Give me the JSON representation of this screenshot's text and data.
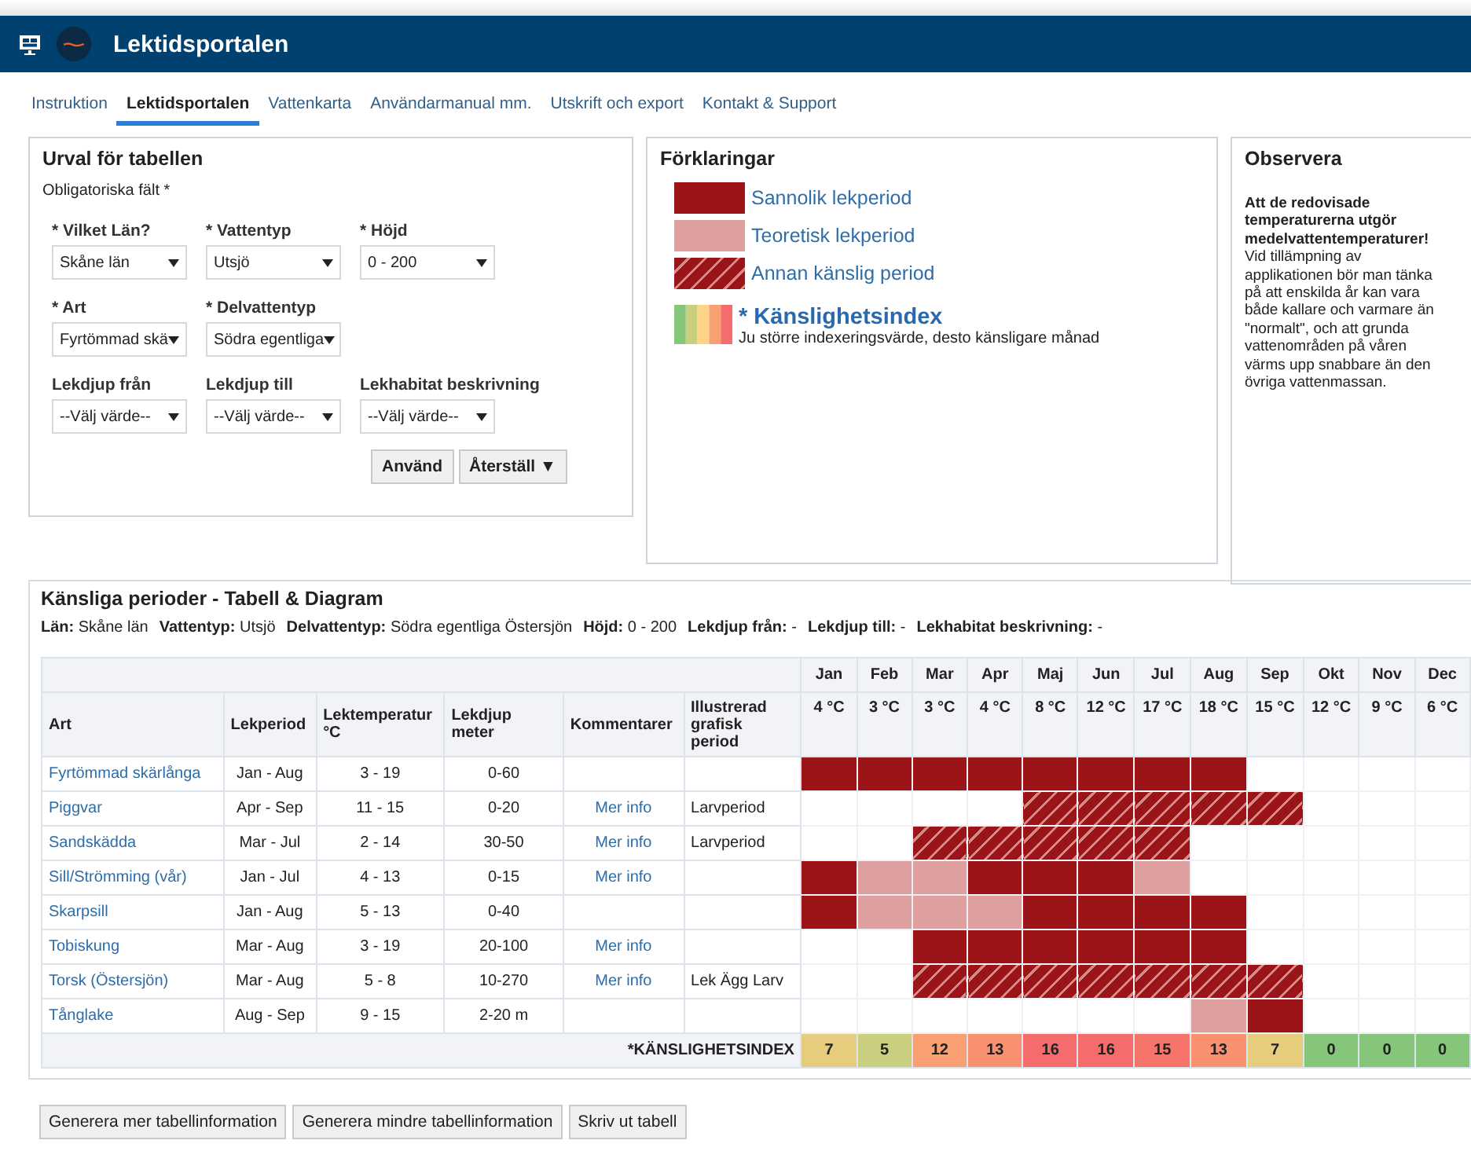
{
  "app_bar": {
    "title": "Lektidsportalen"
  },
  "tabs": [
    {
      "label": "Instruktion",
      "selected": false
    },
    {
      "label": "Lektidsportalen",
      "selected": true
    },
    {
      "label": "Vattenkarta",
      "selected": false
    },
    {
      "label": "Användarmanual mm.",
      "selected": false
    },
    {
      "label": "Utskrift och export",
      "selected": false
    },
    {
      "label": "Kontakt & Support",
      "selected": false
    }
  ],
  "filter_panel": {
    "title": "Urval för tabellen",
    "required_note": "Obligatoriska fält *",
    "field_rows": [
      [
        {
          "label": "* Vilket Län?",
          "value": "Skåne län"
        },
        {
          "label": "* Vattentyp",
          "value": "Utsjö"
        },
        {
          "label": "* Höjd",
          "value": "0 - 200"
        }
      ],
      [
        {
          "label": "* Art",
          "value": "Fyrtömmad skä"
        },
        {
          "label": "* Delvattentyp",
          "value": "Södra egentliga"
        }
      ],
      [
        {
          "label": "Lekdjup från",
          "value": "--Välj värde--"
        },
        {
          "label": "Lekdjup till",
          "value": "--Välj värde--"
        },
        {
          "label": "Lekhabitat beskrivning",
          "value": "--Välj värde--"
        }
      ]
    ],
    "buttons": [
      "Använd",
      "Återställ ▼"
    ]
  },
  "legend_panel": {
    "title": "Förklaringar",
    "items": [
      {
        "label": "Sannolik lekperiod",
        "kind": "probable"
      },
      {
        "label": "Teoretisk lekperiod",
        "kind": "theoretical"
      },
      {
        "label": "Annan känslig period",
        "kind": "other"
      }
    ],
    "index": {
      "title": "* Känslighetsindex",
      "description": "Ju större indexeringsvärde, desto känsligare månad"
    }
  },
  "notice_panel": {
    "title": "Observera",
    "bold_text": "Att de redovisade temperaturerna utgör medelvattentemperaturer!",
    "text": "Vid tillämpning av applikationen bör man tänka på att enskilda år kan vara både kallare och varmare än \"normalt\", och att grunda vattenområden på våren värms upp snabbare än den övriga vattenmassan."
  },
  "table_section": {
    "title": "Känsliga perioder - Tabell & Diagram",
    "summary": [
      {
        "label": "Län:",
        "value": "Skåne län"
      },
      {
        "label": "Vattentyp:",
        "value": "Utsjö"
      },
      {
        "label": "Delvattentyp:",
        "value": "Södra egentliga Östersjön"
      },
      {
        "label": "Höjd:",
        "value": "0 - 200"
      },
      {
        "label": "Lekdjup från:",
        "value": "-"
      },
      {
        "label": "Lekdjup till:",
        "value": "-"
      },
      {
        "label": "Lekhabitat beskrivning:",
        "value": "-"
      }
    ],
    "columns": [
      "Art",
      "Lekperiod",
      "Lektemperatur °C",
      "Lekdjup meter",
      "Kommentarer",
      "Illustrerad grafisk period"
    ],
    "months": [
      {
        "name": "Jan",
        "temp": "4 °C"
      },
      {
        "name": "Feb",
        "temp": "3 °C"
      },
      {
        "name": "Mar",
        "temp": "3 °C"
      },
      {
        "name": "Apr",
        "temp": "4 °C"
      },
      {
        "name": "Maj",
        "temp": "8 °C"
      },
      {
        "name": "Jun",
        "temp": "12 °C"
      },
      {
        "name": "Jul",
        "temp": "17 °C"
      },
      {
        "name": "Aug",
        "temp": "18 °C"
      },
      {
        "name": "Sep",
        "temp": "15 °C"
      },
      {
        "name": "Okt",
        "temp": "12 °C"
      },
      {
        "name": "Nov",
        "temp": "9 °C"
      },
      {
        "name": "Dec",
        "temp": "6 °C"
      }
    ],
    "rows": [
      {
        "art": "Fyrtömmad skärlånga",
        "period": "Jan - Aug",
        "temp": "3 - 19",
        "depth": "0-60",
        "cells": [
          {
            "kind": "probable"
          },
          {
            "kind": "probable"
          },
          {
            "kind": "probable"
          },
          {
            "kind": "probable"
          },
          {
            "kind": "probable"
          },
          {
            "kind": "probable"
          },
          {
            "kind": "probable"
          },
          {
            "kind": "probable"
          },
          {
            "kind": "none"
          },
          {
            "kind": "none"
          },
          {
            "kind": "none"
          },
          {
            "kind": "none"
          }
        ]
      },
      {
        "art": "Piggvar",
        "period": "Apr - Sep",
        "temp": "11 - 15",
        "depth": "0-20",
        "comment": "Mer info",
        "illustrated": "Larvperiod",
        "cells": [
          {
            "kind": "none"
          },
          {
            "kind": "none"
          },
          {
            "kind": "none"
          },
          {
            "kind": "none"
          },
          {
            "kind": "other"
          },
          {
            "kind": "other"
          },
          {
            "kind": "other"
          },
          {
            "kind": "other"
          },
          {
            "kind": "other"
          },
          {
            "kind": "none"
          },
          {
            "kind": "none"
          },
          {
            "kind": "none"
          }
        ]
      },
      {
        "art": "Sandskädda",
        "period": "Mar - Jul",
        "temp": "2 - 14",
        "depth": "30-50",
        "comment": "Mer info",
        "illustrated": "Larvperiod",
        "cells": [
          {
            "kind": "none"
          },
          {
            "kind": "none"
          },
          {
            "kind": "other"
          },
          {
            "kind": "other"
          },
          {
            "kind": "other"
          },
          {
            "kind": "other"
          },
          {
            "kind": "other"
          },
          {
            "kind": "none"
          },
          {
            "kind": "none"
          },
          {
            "kind": "none"
          },
          {
            "kind": "none"
          },
          {
            "kind": "none"
          }
        ]
      },
      {
        "art": "Sill/Strömming (vår)",
        "period": "Jan - Jul",
        "temp": "4 - 13",
        "depth": "0-15",
        "comment": "Mer info",
        "cells": [
          {
            "kind": "probable"
          },
          {
            "kind": "theoretical"
          },
          {
            "kind": "theoretical"
          },
          {
            "kind": "probable"
          },
          {
            "kind": "probable"
          },
          {
            "kind": "probable"
          },
          {
            "kind": "theoretical"
          },
          {
            "kind": "none"
          },
          {
            "kind": "none"
          },
          {
            "kind": "none"
          },
          {
            "kind": "none"
          },
          {
            "kind": "none"
          }
        ]
      },
      {
        "art": "Skarpsill",
        "period": "Jan - Aug",
        "temp": "5 - 13",
        "depth": "0-40",
        "cells": [
          {
            "kind": "probable"
          },
          {
            "kind": "theoretical"
          },
          {
            "kind": "theoretical"
          },
          {
            "kind": "theoretical"
          },
          {
            "kind": "probable"
          },
          {
            "kind": "probable"
          },
          {
            "kind": "probable"
          },
          {
            "kind": "probable"
          },
          {
            "kind": "none"
          },
          {
            "kind": "none"
          },
          {
            "kind": "none"
          },
          {
            "kind": "none"
          }
        ]
      },
      {
        "art": "Tobiskung",
        "period": "Mar - Aug",
        "temp": "3 - 19",
        "depth": "20-100",
        "comment": "Mer info",
        "cells": [
          {
            "kind": "none"
          },
          {
            "kind": "none"
          },
          {
            "kind": "probable"
          },
          {
            "kind": "probable"
          },
          {
            "kind": "probable"
          },
          {
            "kind": "probable"
          },
          {
            "kind": "probable"
          },
          {
            "kind": "probable"
          },
          {
            "kind": "none"
          },
          {
            "kind": "none"
          },
          {
            "kind": "none"
          },
          {
            "kind": "none"
          }
        ]
      },
      {
        "art": "Torsk (Östersjön)",
        "period": "Mar - Aug",
        "temp": "5 - 8",
        "depth": "10-270",
        "comment": "Mer info",
        "illustrated": "Lek Ägg Larv",
        "cells": [
          {
            "kind": "none"
          },
          {
            "kind": "none"
          },
          {
            "kind": "other"
          },
          {
            "kind": "other"
          },
          {
            "kind": "other"
          },
          {
            "kind": "other"
          },
          {
            "kind": "other"
          },
          {
            "kind": "other"
          },
          {
            "kind": "other"
          },
          {
            "kind": "none"
          },
          {
            "kind": "none"
          },
          {
            "kind": "none"
          }
        ]
      },
      {
        "art": "Tånglake",
        "period": "Aug - Sep",
        "temp": "9 - 15",
        "depth": "2-20 m",
        "cells": [
          {
            "kind": "none"
          },
          {
            "kind": "none"
          },
          {
            "kind": "none"
          },
          {
            "kind": "none"
          },
          {
            "kind": "none"
          },
          {
            "kind": "none"
          },
          {
            "kind": "none"
          },
          {
            "kind": "theoretical"
          },
          {
            "kind": "probable"
          },
          {
            "kind": "none"
          },
          {
            "kind": "none"
          },
          {
            "kind": "none"
          }
        ]
      }
    ],
    "index_label": "*KÄNSLIGHETSINDEX",
    "index": [
      {
        "value": "7",
        "color": "#e6cd7e"
      },
      {
        "value": "5",
        "color": "#c9cf7e"
      },
      {
        "value": "12",
        "color": "#f9a073"
      },
      {
        "value": "13",
        "color": "#f9906f"
      },
      {
        "value": "16",
        "color": "#f56c6c"
      },
      {
        "value": "16",
        "color": "#f56c6c"
      },
      {
        "value": "15",
        "color": "#f6746a"
      },
      {
        "value": "13",
        "color": "#f9906f"
      },
      {
        "value": "7",
        "color": "#e6cd7e"
      },
      {
        "value": "0",
        "color": "#86c67a"
      },
      {
        "value": "0",
        "color": "#86c67a"
      },
      {
        "value": "0",
        "color": "#86c67a"
      }
    ]
  },
  "bottom_buttons": [
    "Generera mer tabellinformation",
    "Generera mindre tabellinformation",
    "Skriv ut tabell"
  ]
}
